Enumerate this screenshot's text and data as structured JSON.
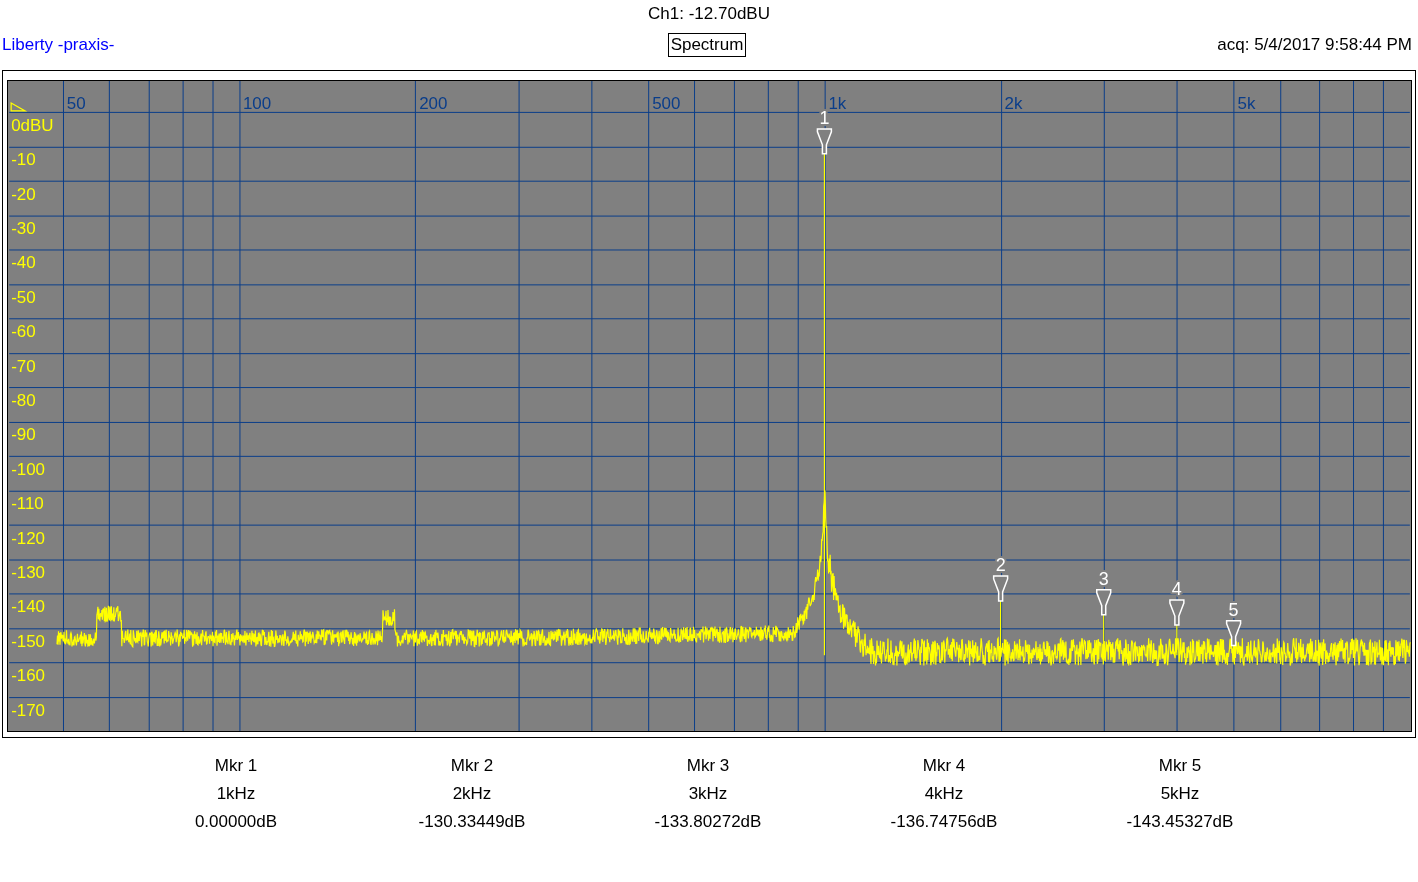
{
  "header": {
    "channel_reading": "Ch1: -12.70dBU",
    "app_name": "Liberty -praxis-",
    "view_title": "Spectrum",
    "acquired": "acq: 5/4/2017 9:58:44 PM"
  },
  "spectrum": {
    "x_axis_labels": [
      "50",
      "100",
      "200",
      "500",
      "1k",
      "2k",
      "5k"
    ],
    "y_axis_labels": [
      "0dBU",
      "-10",
      "-20",
      "-30",
      "-40",
      "-50",
      "-60",
      "-70",
      "-80",
      "-90",
      "-100",
      "-110",
      "-120",
      "-130",
      "-140",
      "-150",
      "-160",
      "-170"
    ],
    "marker_numbers": [
      "1",
      "2",
      "3",
      "4",
      "5"
    ]
  },
  "markers": [
    {
      "name": "Mkr 1",
      "frequency": "1kHz",
      "value": "0.00000dB"
    },
    {
      "name": "Mkr 2",
      "frequency": "2kHz",
      "value": "-130.33449dB"
    },
    {
      "name": "Mkr 3",
      "frequency": "3kHz",
      "value": "-133.80272dB"
    },
    {
      "name": "Mkr 4",
      "frequency": "4kHz",
      "value": "-136.74756dB"
    },
    {
      "name": "Mkr 5",
      "frequency": "5kHz",
      "value": "-143.45327dB"
    }
  ]
}
